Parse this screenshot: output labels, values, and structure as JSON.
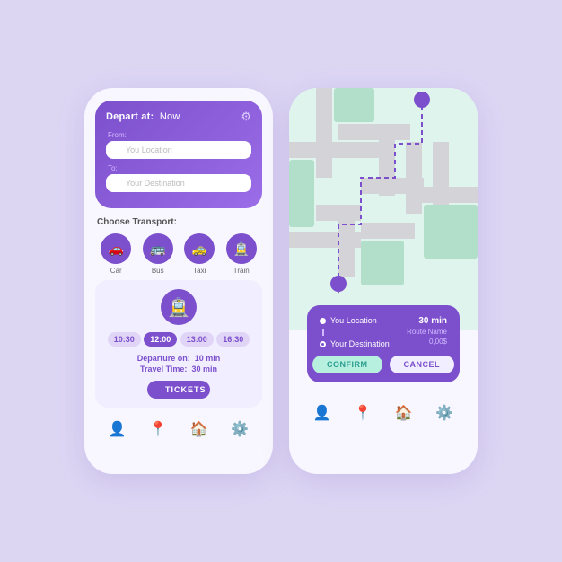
{
  "background": "#ddd6f3",
  "accent": "#7c4fcc",
  "left_phone": {
    "header": {
      "depart_label": "Depart at:",
      "depart_value": "Now",
      "from_label": "From:",
      "from_placeholder": "You Location",
      "to_label": "To:",
      "to_placeholder": "Your Destination"
    },
    "choose_transport_label": "Choose Transport:",
    "transports": [
      {
        "name": "Car",
        "icon": "🚗"
      },
      {
        "name": "Bus",
        "icon": "🚌"
      },
      {
        "name": "Taxi",
        "icon": "🚕"
      },
      {
        "name": "Train",
        "icon": "🚊"
      }
    ],
    "selected_transport_icon": "🚊",
    "times": [
      {
        "value": "10:30",
        "active": false
      },
      {
        "value": "12:00",
        "active": true
      },
      {
        "value": "13:00",
        "active": false
      },
      {
        "value": "16:30",
        "active": false
      }
    ],
    "departure_label": "Departure on:",
    "departure_value": "10 min",
    "travel_label": "Travel Time:",
    "travel_value": "30 min",
    "tickets_btn": "TICKETS"
  },
  "right_phone": {
    "from": "You Location",
    "to": "Your Destination",
    "route_time": "30 min",
    "route_name": "Route Name",
    "route_price": "0,00$",
    "confirm_btn": "CONFIRM",
    "cancel_btn": "CANCEL"
  },
  "nav": {
    "icons": [
      "👤",
      "📍",
      "🏠",
      "⚙️"
    ]
  }
}
